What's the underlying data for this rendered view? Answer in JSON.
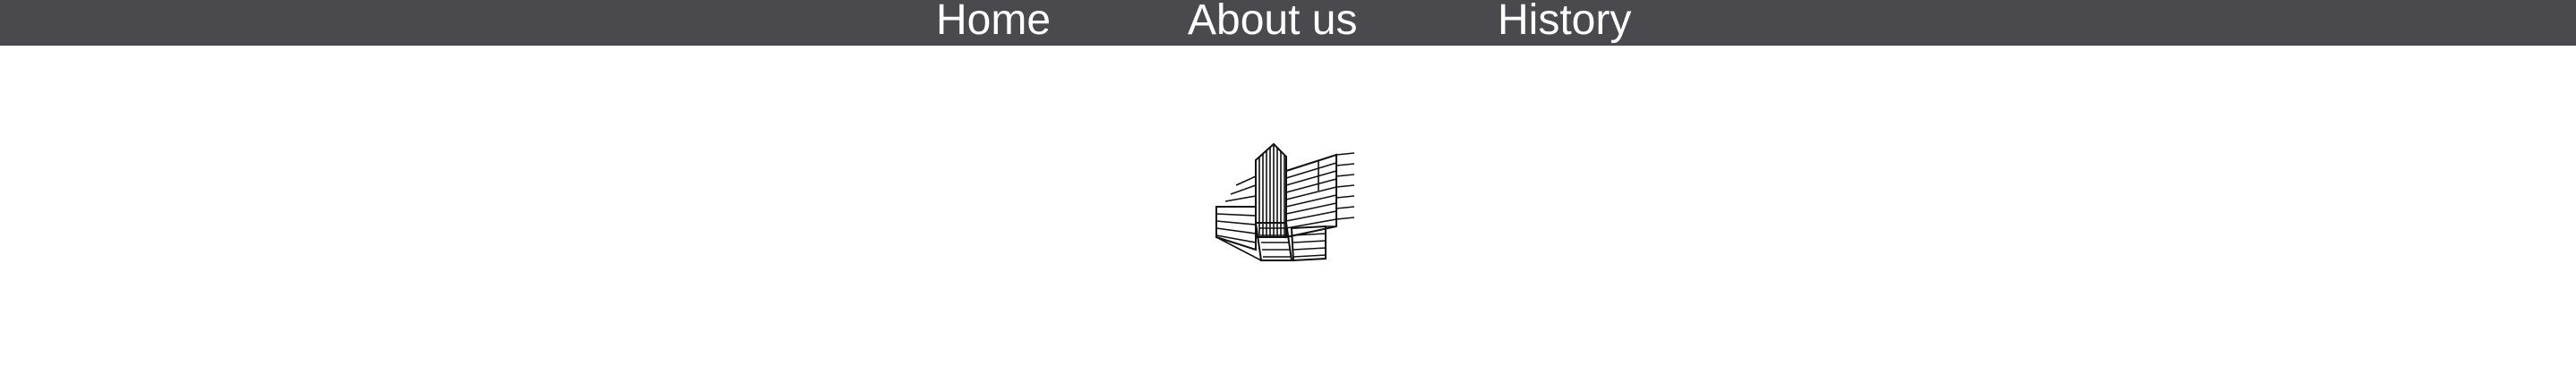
{
  "nav": {
    "items": [
      {
        "label": "Home"
      },
      {
        "label": "About us"
      },
      {
        "label": "History"
      }
    ]
  },
  "logo": {
    "icon": "striped-building-logo-icon"
  },
  "colors": {
    "topbar_bg": "#4a494e",
    "nav_text": "#ffffff",
    "page_bg": "#ffffff",
    "logo_stroke": "#111111"
  }
}
